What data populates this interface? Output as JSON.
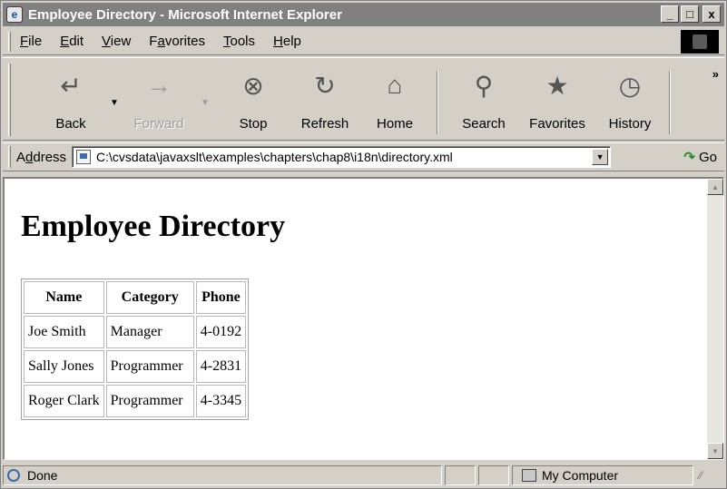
{
  "window": {
    "title": "Employee Directory - Microsoft Internet Explorer",
    "minimize_glyph": "_",
    "maximize_glyph": "□",
    "close_glyph": "x"
  },
  "menu": [
    {
      "pre": "",
      "key": "F",
      "post": "ile"
    },
    {
      "pre": "",
      "key": "E",
      "post": "dit"
    },
    {
      "pre": "",
      "key": "V",
      "post": "iew"
    },
    {
      "pre": "F",
      "key": "a",
      "post": "vorites"
    },
    {
      "pre": "",
      "key": "T",
      "post": "ools"
    },
    {
      "pre": "",
      "key": "H",
      "post": "elp"
    }
  ],
  "toolbar": {
    "back": "Back",
    "forward": "Forward",
    "stop": "Stop",
    "refresh": "Refresh",
    "home": "Home",
    "search": "Search",
    "favorites": "Favorites",
    "history": "History",
    "more": "»"
  },
  "address": {
    "label_pre": "A",
    "label_key": "d",
    "label_post": "dress",
    "value": "C:\\cvsdata\\javaxslt\\examples\\chapters\\chap8\\i18n\\directory.xml",
    "go": "Go"
  },
  "page": {
    "heading": "Employee Directory",
    "columns": [
      "Name",
      "Category",
      "Phone"
    ],
    "rows": [
      [
        "Joe Smith",
        "Manager",
        "4-0192"
      ],
      [
        "Sally Jones",
        "Programmer",
        "4-2831"
      ],
      [
        "Roger Clark",
        "Programmer",
        "4-3345"
      ]
    ]
  },
  "status": {
    "text": "Done",
    "zone": "My Computer"
  }
}
